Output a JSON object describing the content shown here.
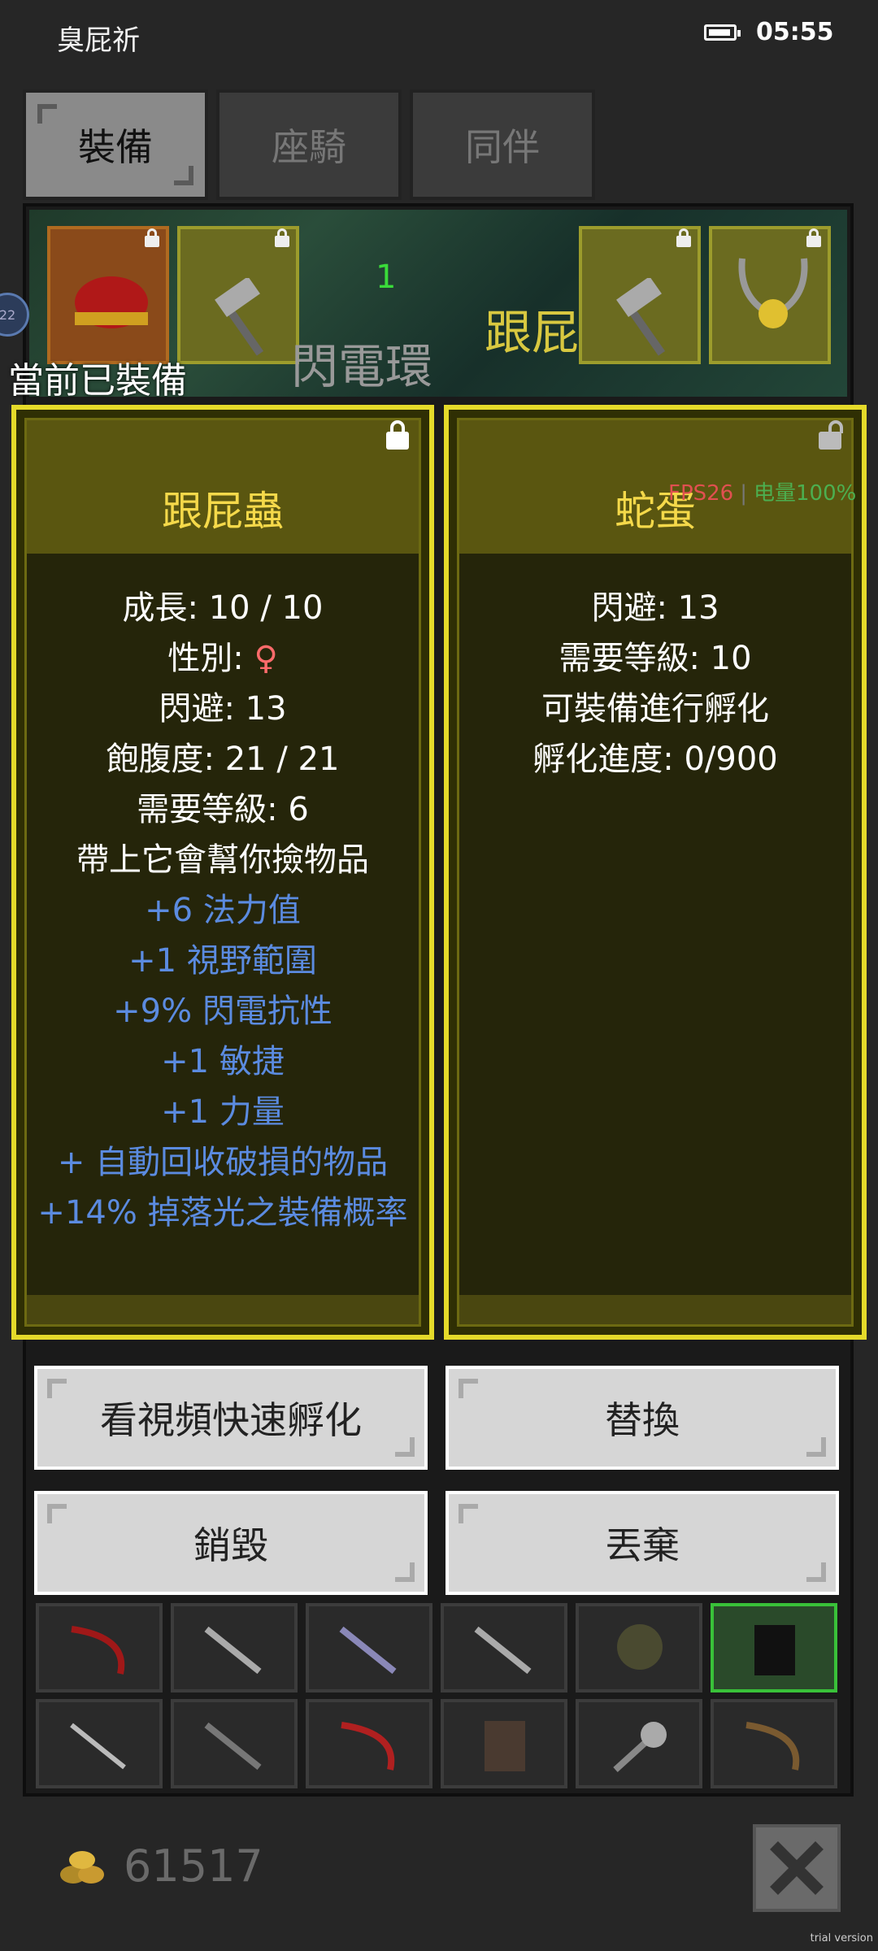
{
  "status_bar": {
    "app_title": "臭屁祈",
    "time": "05:55"
  },
  "tabs": [
    {
      "label": "裝備",
      "active": true
    },
    {
      "label": "座騎",
      "active": false
    },
    {
      "label": "同伴",
      "active": false
    }
  ],
  "scene": {
    "label_left": "閃電環",
    "label_right": "跟屁",
    "label_small": "1"
  },
  "side_badge": "22",
  "equipped_heading": "當前已裝備",
  "left_card": {
    "title": "跟屁蟲",
    "stats": [
      "成長: 10 / 10",
      "閃避: 13",
      "飽腹度: 21 / 21",
      "需要等級: 6",
      "帶上它會幫你撿物品"
    ],
    "gender_label": "性別: ",
    "gender_symbol": "♀",
    "bonuses": [
      "+6 法力值",
      "+1 視野範圍",
      "+9% 閃電抗性",
      "+1 敏捷",
      "+1 力量",
      "+ 自動回收破損的物品",
      "+14% 掉落光之裝備概率"
    ]
  },
  "right_card": {
    "title": "蛇蛋",
    "stats": [
      "閃避: 13",
      "需要等級: 10",
      "可裝備進行孵化",
      "孵化進度: 0/900"
    ]
  },
  "fps_overlay": {
    "fps": "FPS26",
    "battery": "电量100%"
  },
  "buttons": {
    "watch_video": "看視頻快速孵化",
    "replace": "替換",
    "destroy": "銷毀",
    "discard": "丟棄"
  },
  "gold": "61517",
  "trial_text": "trial version",
  "colors": {
    "accent_yellow": "#e5da2a",
    "bonus_blue": "#5b8be0",
    "female_pink": "#ff6b6b",
    "title_gold": "#f5d94a"
  }
}
